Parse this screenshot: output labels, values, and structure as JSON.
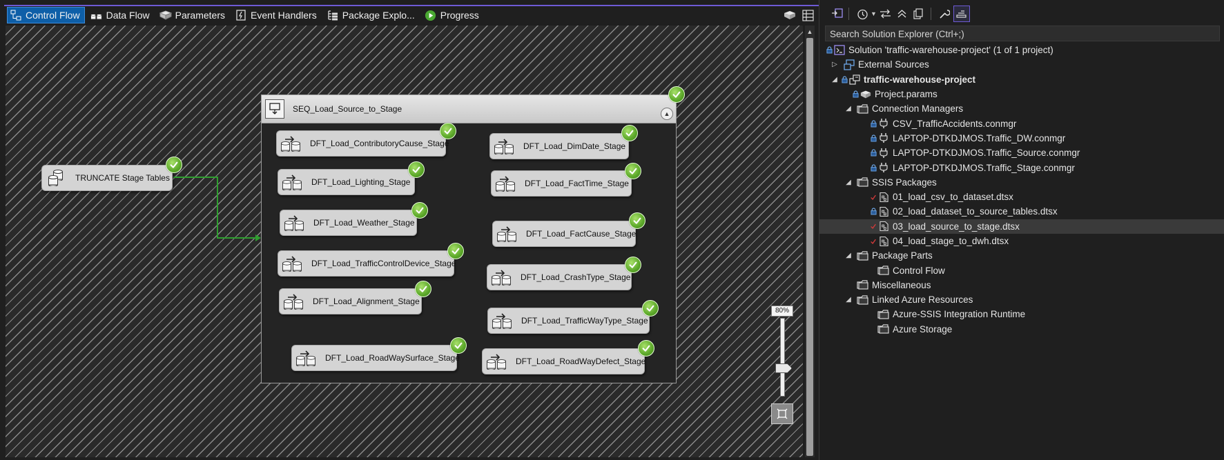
{
  "designer": {
    "tabs": [
      {
        "label": "Control Flow",
        "icon": "control-flow-icon",
        "active": true
      },
      {
        "label": "Data Flow",
        "icon": "data-flow-icon"
      },
      {
        "label": "Parameters",
        "icon": "parameters-icon"
      },
      {
        "label": "Event Handlers",
        "icon": "event-handlers-icon"
      },
      {
        "label": "Package Explo...",
        "icon": "package-explorer-icon"
      },
      {
        "label": "Progress",
        "icon": "progress-play-icon"
      }
    ],
    "truncate_task": {
      "label": "TRUNCATE Stage Tables",
      "status": "success"
    },
    "sequence": {
      "label": "SEQ_Load_Source_to_Stage",
      "status": "success",
      "tasks": [
        {
          "label": "DFT_Load_ContributoryCause_Stage",
          "status": "success"
        },
        {
          "label": "DFT_Load_Lighting_Stage",
          "status": "success"
        },
        {
          "label": "DFT_Load_Weather_Stage",
          "status": "success"
        },
        {
          "label": "DFT_Load_TrafficControlDevice_Stage",
          "status": "success"
        },
        {
          "label": "DFT_Load_Alignment_Stage",
          "status": "success"
        },
        {
          "label": "DFT_Load_RoadWaySurface_Stage",
          "status": "success"
        },
        {
          "label": "DFT_Load_DimDate_Stage",
          "status": "success"
        },
        {
          "label": "DFT_Load_FactTime_Stage",
          "status": "success"
        },
        {
          "label": "DFT_Load_FactCause_Stage",
          "status": "success"
        },
        {
          "label": "DFT_Load_CrashType_Stage",
          "status": "success"
        },
        {
          "label": "DFT_Load_TrafficWayType_Stage",
          "status": "success"
        },
        {
          "label": "DFT_Load_RoadWayDefect_Stage",
          "status": "success"
        }
      ]
    },
    "zoom_level": "80%",
    "colors": {
      "active_tab": "#0e5fa8",
      "success": "#5ca82a",
      "connector": "#2f9e2f",
      "accent": "#6e5ad6"
    }
  },
  "solution_explorer": {
    "search_placeholder": "Search Solution Explorer (Ctrl+;)",
    "items": [
      {
        "label": "Solution 'traffic-warehouse-project' (1 of 1 project)"
      },
      {
        "label": "External Sources"
      },
      {
        "label": "traffic-warehouse-project"
      },
      {
        "label": "Project.params"
      },
      {
        "label": "Connection Managers"
      },
      {
        "label": "CSV_TrafficAccidents.conmgr"
      },
      {
        "label": "LAPTOP-DTKDJMOS.Traffic_DW.conmgr"
      },
      {
        "label": "LAPTOP-DTKDJMOS.Traffic_Source.conmgr"
      },
      {
        "label": "LAPTOP-DTKDJMOS.Traffic_Stage.conmgr"
      },
      {
        "label": "SSIS Packages"
      },
      {
        "label": "01_load_csv_to_dataset.dtsx"
      },
      {
        "label": "02_load_dataset_to_source_tables.dtsx"
      },
      {
        "label": "03_load_source_to_stage.dtsx"
      },
      {
        "label": "04_load_stage_to_dwh.dtsx"
      },
      {
        "label": "Package Parts"
      },
      {
        "label": "Control Flow"
      },
      {
        "label": "Miscellaneous"
      },
      {
        "label": "Linked Azure Resources"
      },
      {
        "label": "Azure-SSIS Integration Runtime"
      },
      {
        "label": "Azure Storage"
      }
    ]
  }
}
